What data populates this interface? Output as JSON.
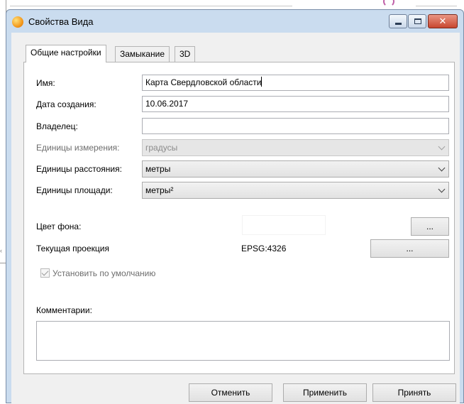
{
  "window": {
    "title": "Свойства Вида",
    "close_glyph": "✕"
  },
  "tabs": [
    {
      "label": "Общие настройки",
      "active": true
    },
    {
      "label": "Замыкание",
      "active": false
    },
    {
      "label": "3D",
      "active": false
    }
  ],
  "fields": {
    "name": {
      "label": "Имя:",
      "value": "Карта Свердловской области"
    },
    "created": {
      "label": "Дата создания:",
      "value": "10.06.2017"
    },
    "owner": {
      "label": "Владелец:",
      "value": ""
    },
    "measure_units": {
      "label": "Единицы измерения:",
      "value": "градусы",
      "disabled": true
    },
    "distance_units": {
      "label": "Единицы расстояния:",
      "value": "метры"
    },
    "area_units": {
      "label": "Единицы площади:",
      "value": "метры²"
    }
  },
  "background": {
    "label": "Цвет фона:",
    "color": "#ffffff",
    "button": "..."
  },
  "projection": {
    "label": "Текущая проекция",
    "value": "EPSG:4326",
    "button": "..."
  },
  "default_checkbox": {
    "label": "Установить по умолчанию",
    "checked": true,
    "disabled": true
  },
  "comments": {
    "label": "Комментарии:",
    "value": ""
  },
  "buttons": {
    "cancel": "Отменить",
    "apply": "Применить",
    "accept": "Принять"
  },
  "colors": {
    "frame": "#cadcef",
    "client": "#f0f0f0",
    "close_button": "#c8462f",
    "accent_bar": "#7d2a6a"
  }
}
